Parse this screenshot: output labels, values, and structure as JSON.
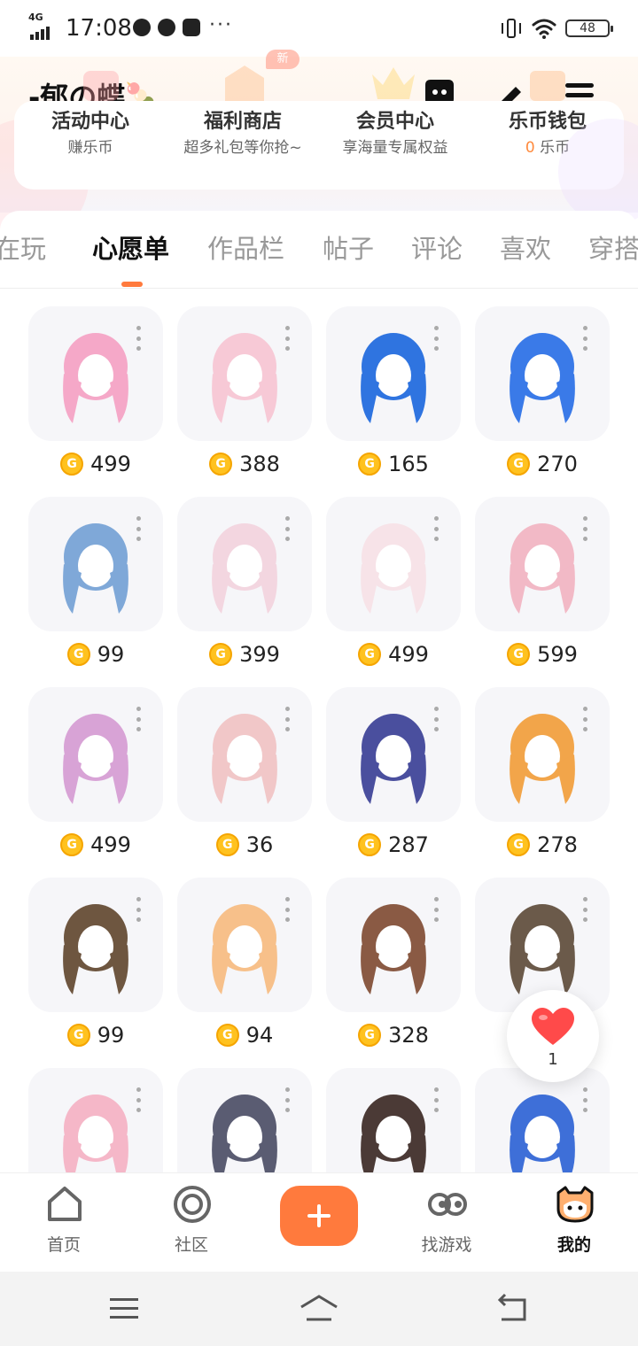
{
  "status_bar": {
    "network": "4G",
    "time": "17:08",
    "battery": "48",
    "dots": "···"
  },
  "profile": {
    "username": "-郁の蝶🍡_"
  },
  "features": [
    {
      "title": "活动中心",
      "sub": "赚乐币",
      "icon": "activity-icon"
    },
    {
      "title": "福利商店",
      "sub": "超多礼包等你抢~",
      "icon": "shop-icon",
      "badge": "新"
    },
    {
      "title": "会员中心",
      "sub": "享海量专属权益",
      "icon": "crown-icon"
    },
    {
      "title": "乐币钱包",
      "sub_value": "0",
      "sub_unit": "乐币",
      "icon": "wallet-icon"
    }
  ],
  "tabs": [
    "在玩",
    "心愿单",
    "作品栏",
    "帖子",
    "评论",
    "喜欢",
    "穿搭"
  ],
  "active_tab": "心愿单",
  "wishlist": [
    {
      "price": "499",
      "icon": "pink-bear-ear-hair-icon"
    },
    {
      "price": "388",
      "icon": "pink-skirt-icon"
    },
    {
      "price": "165",
      "icon": "blue-bun-hair-icon"
    },
    {
      "price": "270",
      "icon": "blue-maid-bob-hair-icon"
    },
    {
      "price": "99",
      "icon": "anime-eye-icon"
    },
    {
      "price": "399",
      "icon": "pink-boots-icon"
    },
    {
      "price": "499",
      "icon": "teddy-bear-icon"
    },
    {
      "price": "599",
      "icon": "striped-sweater-icon"
    },
    {
      "price": "499",
      "icon": "pink-long-hair-icon"
    },
    {
      "price": "36",
      "icon": "pink-beanie-hair-icon"
    },
    {
      "price": "287",
      "icon": "navy-dress-outfit-icon"
    },
    {
      "price": "278",
      "icon": "orange-long-hair-icon"
    },
    {
      "price": "99",
      "icon": "brown-long-hair-icon"
    },
    {
      "price": "94",
      "icon": "peach-short-hair-icon"
    },
    {
      "price": "328",
      "icon": "brown-wavy-hair-icon"
    },
    {
      "price": "",
      "icon": "brown-cap-hair-icon"
    },
    {
      "price": "",
      "icon": "pink-dress-outfit-icon"
    },
    {
      "price": "",
      "icon": "grey-gown-icon"
    },
    {
      "price": "",
      "icon": "dark-robe-icon"
    },
    {
      "price": "",
      "icon": "blue-white-dress-icon"
    }
  ],
  "coin_symbol": "G",
  "like_fab": {
    "count": "1"
  },
  "bottom_nav": [
    {
      "label": "首页",
      "icon": "home-icon"
    },
    {
      "label": "社区",
      "icon": "community-icon"
    },
    {
      "label": "",
      "icon": "plus-icon"
    },
    {
      "label": "找游戏",
      "icon": "find-game-icon"
    },
    {
      "label": "我的",
      "icon": "profile-icon",
      "active": true
    }
  ],
  "colors": {
    "accent": "#ff7a3d",
    "coin": "#ffc21f",
    "like": "#ff4a4a"
  }
}
